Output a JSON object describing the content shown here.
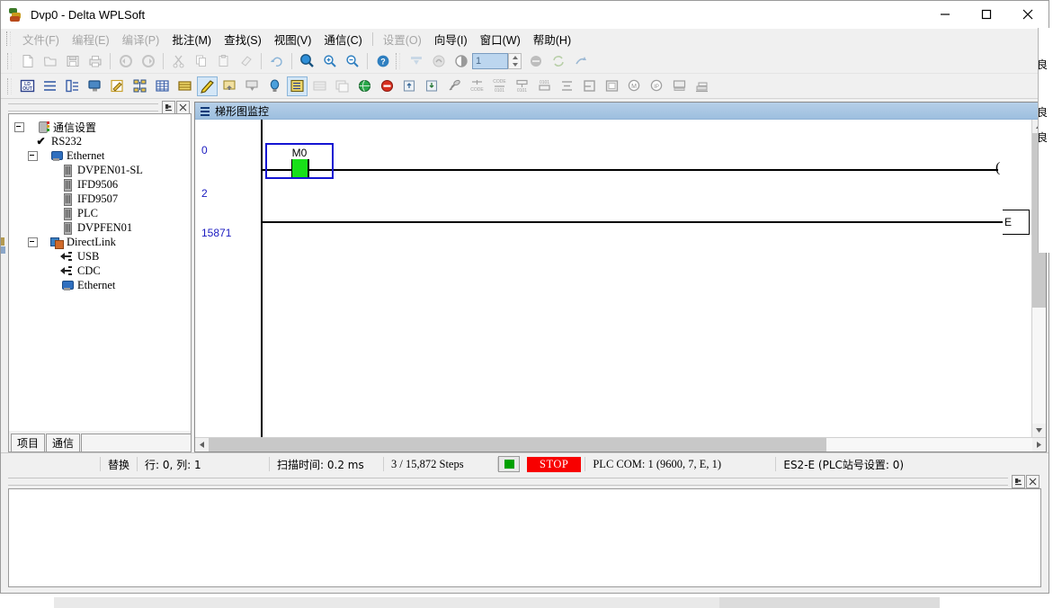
{
  "window": {
    "title": "Dvp0 - Delta WPLSoft",
    "icon": "delta-logo-icon",
    "controls": [
      {
        "name": "minimize-button",
        "glyph": "minimize-icon"
      },
      {
        "name": "maximize-button",
        "glyph": "maximize-icon"
      },
      {
        "name": "close-button",
        "glyph": "close-icon"
      }
    ]
  },
  "menubar": {
    "items": [
      {
        "label": "文件(F)",
        "disabled": true
      },
      {
        "label": "编程(E)",
        "disabled": true
      },
      {
        "label": "编译(P)",
        "disabled": true
      },
      {
        "label": "批注(M)",
        "disabled": false
      },
      {
        "label": "查找(S)",
        "disabled": false
      },
      {
        "label": "视图(V)",
        "disabled": false
      },
      {
        "label": "通信(C)",
        "disabled": false
      },
      {
        "label": "设置(O)",
        "disabled": true
      },
      {
        "label": "向导(I)",
        "disabled": false
      },
      {
        "label": "窗口(W)",
        "disabled": false
      },
      {
        "label": "帮助(H)",
        "disabled": false
      }
    ]
  },
  "toolbar_main": {
    "spinner_value": "1",
    "buttons": [
      {
        "name": "new-file-icon",
        "disabled": true
      },
      {
        "name": "open-file-icon",
        "disabled": true
      },
      {
        "name": "save-file-icon",
        "disabled": true
      },
      {
        "name": "print-icon",
        "disabled": true
      },
      {
        "name": "undo-icon",
        "disabled": true
      },
      {
        "name": "redo-icon",
        "disabled": true
      },
      {
        "name": "cut-icon",
        "disabled": true
      },
      {
        "name": "copy-icon",
        "disabled": true
      },
      {
        "name": "paste-icon",
        "disabled": true
      },
      {
        "name": "delete-icon",
        "disabled": true
      },
      {
        "name": "refresh-arrow-icon",
        "disabled": true
      },
      {
        "name": "zoom-icon",
        "disabled": false
      },
      {
        "name": "zoom-in-icon",
        "disabled": false
      },
      {
        "name": "zoom-out-icon",
        "disabled": false
      },
      {
        "name": "help-question-icon",
        "disabled": false
      },
      {
        "name": "download-to-plc-icon",
        "disabled": true
      },
      {
        "name": "upload-from-plc-icon",
        "disabled": true
      },
      {
        "name": "power-state-icon",
        "disabled": true
      },
      {
        "name": "stop-circle-icon",
        "disabled": true
      },
      {
        "name": "sync-icon",
        "disabled": true
      },
      {
        "name": "run-arrow-icon",
        "disabled": true
      }
    ]
  },
  "toolbar_ladder": {
    "buttons": [
      {
        "name": "ld-out-icon",
        "active": false
      },
      {
        "name": "ladder-view-icon",
        "active": false
      },
      {
        "name": "instruction-list-icon",
        "active": false
      },
      {
        "name": "plc-monitor-icon",
        "active": false
      },
      {
        "name": "edit-pencil-icon",
        "active": false
      },
      {
        "name": "network-tree-icon",
        "active": false
      },
      {
        "name": "grid-table-icon",
        "active": false
      },
      {
        "name": "register-table-icon",
        "active": false
      },
      {
        "name": "ladder-monitor-pen-icon",
        "active": true
      },
      {
        "name": "device-monitor-icon",
        "active": false
      },
      {
        "name": "device-write-icon",
        "active": false
      },
      {
        "name": "bulb-icon",
        "active": false
      },
      {
        "name": "ladder-monitor-hex-icon",
        "active": true
      },
      {
        "name": "grid-faded-icon",
        "active": false
      },
      {
        "name": "copy-window-icon",
        "active": false
      },
      {
        "name": "globe-green-icon",
        "active": false
      },
      {
        "name": "stop-red-icon",
        "active": false
      },
      {
        "name": "export-box-icon",
        "active": false
      },
      {
        "name": "import-box-icon",
        "active": false
      },
      {
        "name": "antenna-icon",
        "active": false
      },
      {
        "name": "code-compare-icon",
        "active": false
      },
      {
        "name": "code-convert-icon",
        "active": false
      },
      {
        "name": "network-compare-icon",
        "active": false
      },
      {
        "name": "binary-data-icon",
        "active": false
      },
      {
        "name": "align-icon",
        "active": false
      },
      {
        "name": "merge-icon",
        "active": false
      },
      {
        "name": "frame-icon",
        "active": false
      },
      {
        "name": "magnifier-m-icon",
        "active": false
      },
      {
        "name": "magnifier-ip-icon",
        "active": false
      },
      {
        "name": "pc-link-icon",
        "active": false
      },
      {
        "name": "stack-icon",
        "active": false
      }
    ]
  },
  "left_dock": {
    "pin_button": "pin-icon",
    "close_button": "close-icon",
    "tree": [
      {
        "label": "通信设置",
        "depth": 0,
        "icon": "communication-settings-icon",
        "expander": "minus",
        "style": "cn"
      },
      {
        "label": "RS232",
        "depth": 1,
        "icon": "check-icon",
        "expander": "none",
        "style": "mono"
      },
      {
        "label": "Ethernet",
        "depth": 1,
        "icon": "ethernet-icon",
        "expander": "minus",
        "style": "mono"
      },
      {
        "label": "DVPEN01-SL",
        "depth": 2,
        "icon": "device-icon",
        "expander": "none",
        "style": "mono"
      },
      {
        "label": "IFD9506",
        "depth": 2,
        "icon": "device-icon",
        "expander": "none",
        "style": "mono"
      },
      {
        "label": "IFD9507",
        "depth": 2,
        "icon": "device-icon",
        "expander": "none",
        "style": "mono"
      },
      {
        "label": "PLC",
        "depth": 2,
        "icon": "device-icon",
        "expander": "none",
        "style": "mono"
      },
      {
        "label": "DVPFEN01",
        "depth": 2,
        "icon": "device-icon",
        "expander": "none",
        "style": "mono"
      },
      {
        "label": "DirectLink",
        "depth": 1,
        "icon": "directlink-icon",
        "expander": "minus",
        "style": "mono"
      },
      {
        "label": "USB",
        "depth": 2,
        "icon": "usb-icon",
        "expander": "none",
        "style": "mono"
      },
      {
        "label": "CDC",
        "depth": 2,
        "icon": "usb-icon",
        "expander": "none",
        "style": "mono"
      },
      {
        "label": "Ethernet",
        "depth": 2,
        "icon": "ethernet-icon",
        "expander": "none",
        "style": "mono"
      }
    ],
    "tabs": [
      {
        "label": "项目",
        "selected": true
      },
      {
        "label": "通信",
        "selected": false
      }
    ]
  },
  "mdi": {
    "title": "梯形图监控",
    "icon": "ladder-monitor-icon",
    "ladder": {
      "row_numbers": [
        "0",
        "2",
        "15871"
      ],
      "contact": {
        "label": "M0",
        "state": "on",
        "selected": true
      },
      "coil_symbol": "(",
      "end_block": "E"
    },
    "scroll": {
      "up_arrow": "chevron-up-icon",
      "down_arrow": "chevron-down-icon",
      "left_arrow": "chevron-left-icon",
      "right_arrow": "chevron-right-icon"
    }
  },
  "statusbar": {
    "replace_mode": "替换",
    "cursor": "行: 0, 列: 1",
    "scan_time": "扫描时间: 0.2 ms",
    "steps": "3 / 15,872 Steps",
    "run_indicator": "green-square-icon",
    "plc_state": "STOP",
    "plc_com": "PLC COM: 1 (9600, 7, E, 1)",
    "plc_model": "ES2-E (PLC站号设置: 0)"
  },
  "bottom_dock": {
    "pin_button": "pin-icon",
    "close_button": "close-icon",
    "output_text": ""
  },
  "right_strip": {
    "chars": [
      "良",
      "良",
      "良"
    ]
  },
  "colors": {
    "accent_blue": "#1414d2",
    "contact_on_green": "#18e018",
    "stop_red": "#f80000",
    "title_gradient_top": "#b6cfe8",
    "title_gradient_bottom": "#9dbfdf",
    "row_number_blue": "#1a1ac0",
    "toolbar_active": "#d4e7f7"
  }
}
